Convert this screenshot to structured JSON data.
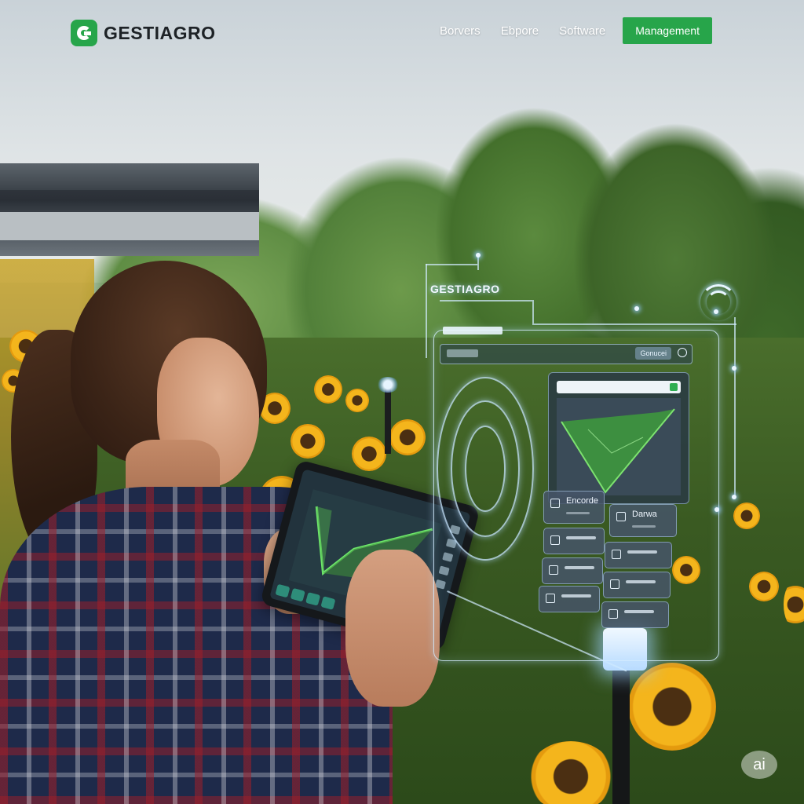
{
  "brand": {
    "name": "GESTIAGRO",
    "accent_color": "#27a54a",
    "logo_icon": "g-logo-icon"
  },
  "nav": {
    "links": [
      "Borvers",
      "Ebpore",
      "Software"
    ],
    "cta_label": "Management"
  },
  "hologram": {
    "title": "GESTIAGRO",
    "bar_button_label": "Gonucei",
    "widgets": [
      {
        "label": "Encorde"
      },
      {
        "label": "Darwa"
      }
    ],
    "wifi_icon": "wifi-icon"
  },
  "watermark": "ai"
}
